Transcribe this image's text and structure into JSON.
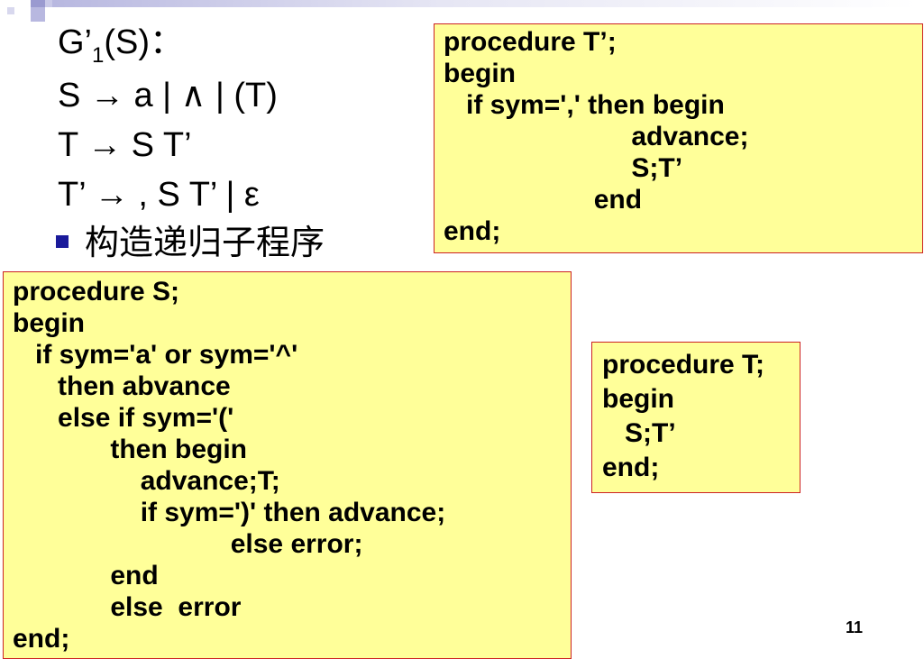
{
  "grammar": {
    "title_main": "G’",
    "title_sub": "1",
    "title_rest": "(S)：",
    "rules": [
      "S → a | ∧ | (T)",
      "T → S T’",
      "T’ → , S T’ | ε"
    ]
  },
  "bullet": {
    "text": "构造递归子程序",
    "color": "#1a1a9a"
  },
  "procedure_t_prime": {
    "lines": [
      "procedure T’;",
      "begin",
      "   if sym=',' then begin",
      "                         advance;",
      "                         S;T’",
      "                    end",
      "end;"
    ]
  },
  "procedure_s": {
    "lines": [
      "procedure S;",
      "begin",
      "   if sym='a' or sym='^'",
      "      then abvance",
      "      else if sym='('",
      "             then begin",
      "                 advance;T;",
      "                 if sym=')' then advance;",
      "                             else error;",
      "             end",
      "             else  error",
      "end;"
    ]
  },
  "procedure_t": {
    "lines": [
      "procedure T;",
      "begin",
      "   S;T’",
      "end;"
    ]
  },
  "page_number": "11",
  "colors": {
    "box_fill": "#ffff99",
    "box_border": "#cc2222"
  }
}
